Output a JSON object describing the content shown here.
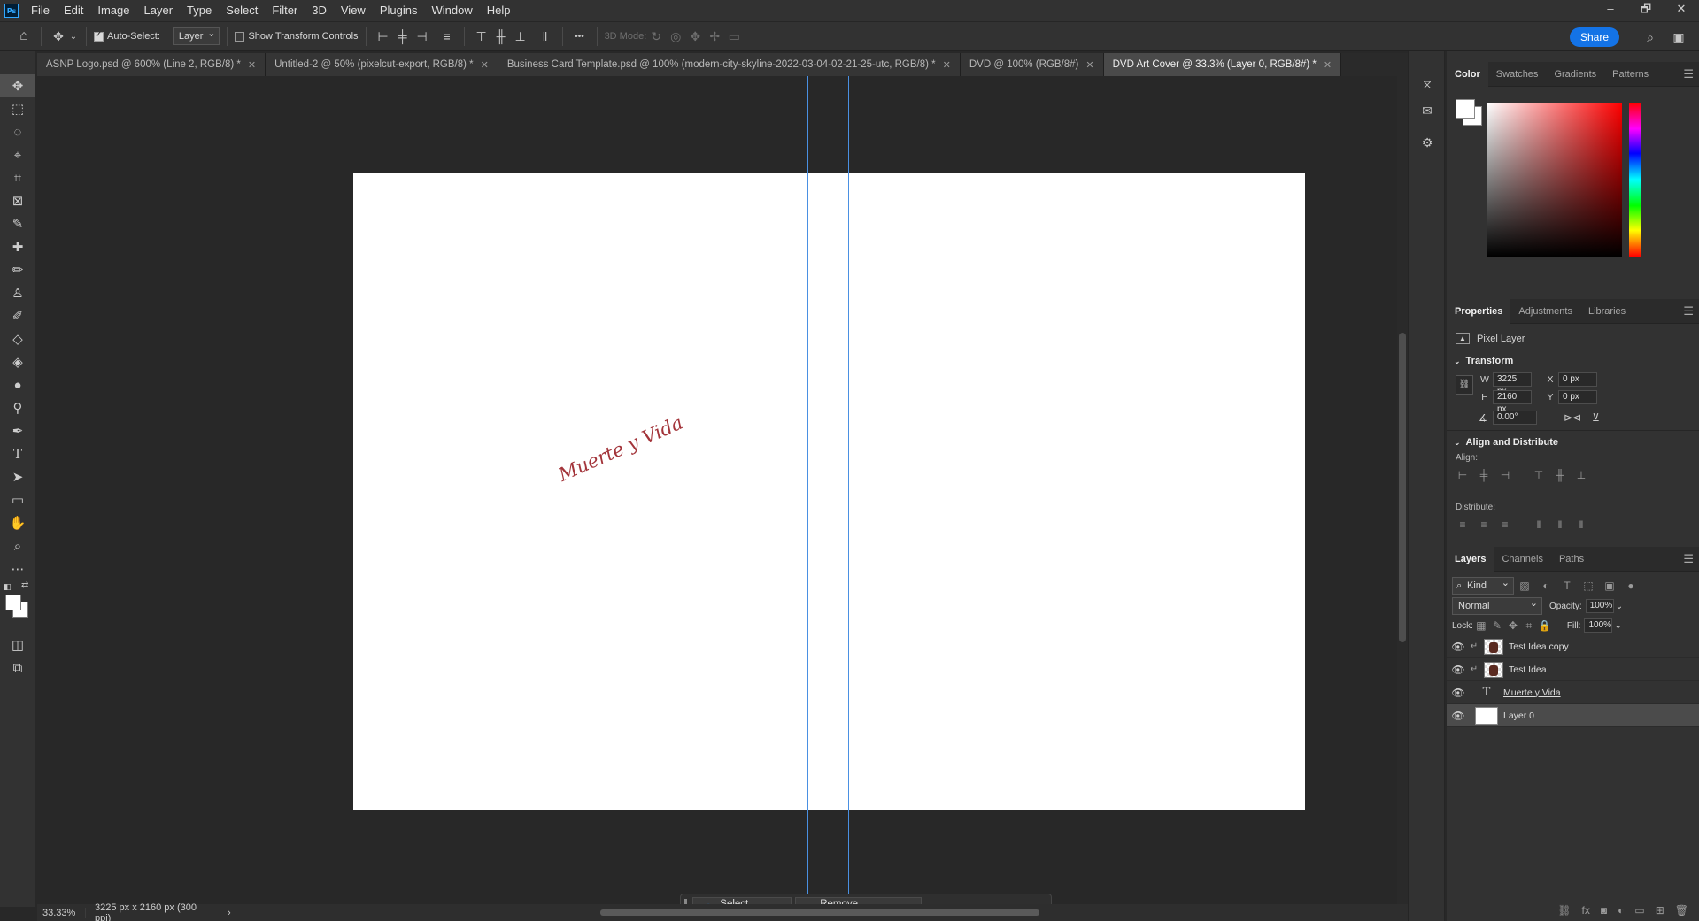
{
  "app": {
    "logo_text": "Ps"
  },
  "menubar": {
    "items": [
      "File",
      "Edit",
      "Image",
      "Layer",
      "Type",
      "Select",
      "Filter",
      "3D",
      "View",
      "Plugins",
      "Window",
      "Help"
    ],
    "win_controls": [
      "–",
      "🗗",
      "✕"
    ]
  },
  "options": {
    "auto_select_label": "Auto-Select:",
    "auto_select_checked": true,
    "auto_select_target": "Layer",
    "show_transform_label": "Show Transform Controls",
    "mode_3d_label": "3D Mode:",
    "more": "•••",
    "share_label": "Share"
  },
  "tabs": [
    {
      "title": "ASNP Logo.psd @ 600% (Line 2, RGB/8) *",
      "active": false
    },
    {
      "title": "Untitled-2 @ 50% (pixelcut-export, RGB/8) *",
      "active": false
    },
    {
      "title": "Business Card Template.psd @ 100% (modern-city-skyline-2022-03-04-02-21-25-utc, RGB/8) *",
      "active": false
    },
    {
      "title": "DVD @ 100% (RGB/8#)",
      "active": false
    },
    {
      "title": "DVD Art Cover @ 33.3% (Layer 0, RGB/8#) *",
      "active": true
    }
  ],
  "canvas": {
    "text": "Muerte y Vida"
  },
  "context_bar": {
    "select_subject": "Select subject",
    "remove_background": "Remove background"
  },
  "status": {
    "zoom": "33.33%",
    "doc_info": "3225 px x 2160 px (300 ppi)"
  },
  "color_panel": {
    "tabs": [
      "Color",
      "Swatches",
      "Gradients",
      "Patterns"
    ],
    "foreground": "#ffffff",
    "background": "#ffffff"
  },
  "properties_panel": {
    "tabs": [
      "Properties",
      "Adjustments",
      "Libraries"
    ],
    "layer_type": "Pixel Layer",
    "transform_title": "Transform",
    "w_label": "W",
    "w_value": "3225 px",
    "h_label": "H",
    "h_value": "2160 px",
    "x_label": "X",
    "x_value": "0 px",
    "y_label": "Y",
    "y_value": "0 px",
    "angle_value": "0.00°",
    "align_title": "Align and Distribute",
    "align_label": "Align:",
    "distribute_label": "Distribute:"
  },
  "layers_panel": {
    "tabs": [
      "Layers",
      "Channels",
      "Paths"
    ],
    "filter_kind": "Kind",
    "blend_mode": "Normal",
    "opacity_label": "Opacity:",
    "opacity_value": "100%",
    "lock_label": "Lock:",
    "fill_label": "Fill:",
    "fill_value": "100%",
    "layers": [
      {
        "name": "Test Idea copy",
        "kind": "image"
      },
      {
        "name": "Test Idea",
        "kind": "image"
      },
      {
        "name": "Muerte y Vida",
        "kind": "text"
      },
      {
        "name": "Layer 0",
        "kind": "white",
        "selected": true
      }
    ]
  }
}
